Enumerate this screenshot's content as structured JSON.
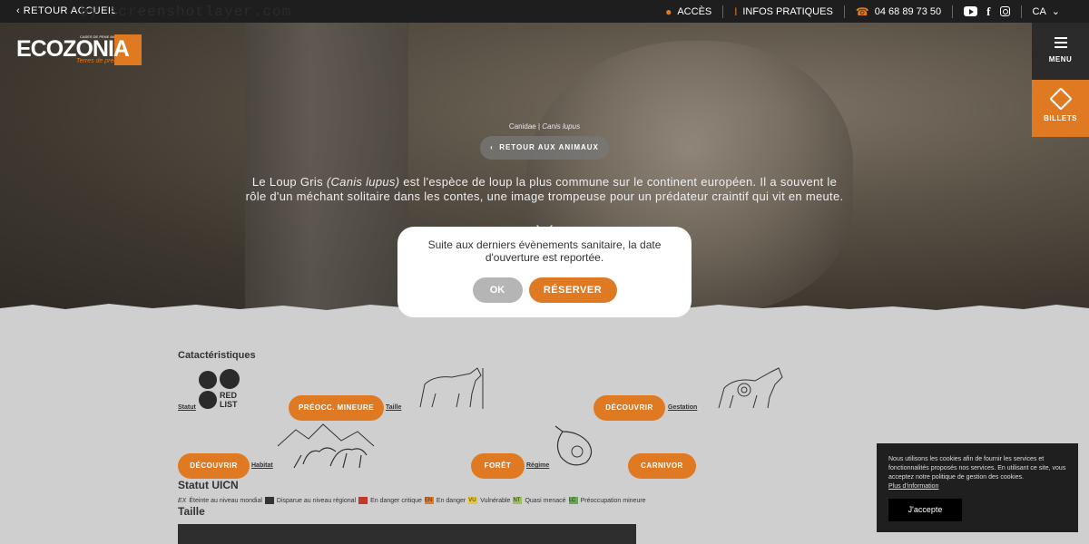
{
  "topbar": {
    "back_label": "RETOUR ACCUEIL",
    "watermark": "by screenshotlayer.com",
    "access_label": "ACCÈS",
    "info_label": "INFOS PRATIQUES",
    "phone": "04 68 89 73 50",
    "lang": "CA",
    "social_icons": [
      "youtube-icon",
      "facebook-icon",
      "instagram-icon"
    ]
  },
  "logo": {
    "word": "ECOZONIA",
    "tagline": "Terres de prédateurs",
    "tiny": "CASES DE PENE 66"
  },
  "side": {
    "menu_label": "MENU",
    "tickets_label": "BILLETS"
  },
  "hero": {
    "family": "Canidae |",
    "species": "Canis lupus",
    "back_button": "RETOUR AUX ANIMAUX",
    "intro_name": "Le Loup Gris",
    "intro_latin": "(Canis lupus)",
    "intro_text": "est l'espèce de loup la plus commune sur le continent européen. Il a souvent le rôle d'un méchant solitaire dans les contes, une image trompeuse pour un prédateur craintif qui vit en meute."
  },
  "modal": {
    "message": "Suite aux derniers évènements sanitaire, la date d'ouverture est reportée.",
    "ok_label": "OK",
    "reserve_label": "RÉSERVER"
  },
  "content": {
    "heading": "Catactéristiques",
    "redlist_text": "RED LIST",
    "statut_label": "Statut",
    "statut_value": "PRÉOCC. MINEURE",
    "taille_label": "Taille",
    "taille_value": "DÉCOUVRIR",
    "gestation_label": "Gestation",
    "habitat_value": "DÉCOUVRIR",
    "habitat_label": "Habitat",
    "habitat_type": "FORÊT",
    "regime_label": "Régime",
    "regime_value": "CARNIVOR",
    "uicn_heading": "Statut UICN",
    "legend": [
      {
        "code": "EX",
        "label": "Éteinte au niveau mondial",
        "color": ""
      },
      {
        "code": "",
        "label": "Disparue au niveau régional",
        "color": "#333333"
      },
      {
        "code": "",
        "label": "En danger critique",
        "color": "#c0392b"
      },
      {
        "code": "EN",
        "label": "En danger",
        "color": "#e07a22"
      },
      {
        "code": "VU",
        "label": "Vulnérable",
        "color": "#e8c83a"
      },
      {
        "code": "NT",
        "label": "Quasi menacé",
        "color": "#9bbf5a"
      },
      {
        "code": "LC",
        "label": "Préoccupation mineure",
        "color": "#6aa84f"
      }
    ],
    "taille_heading": "Taille"
  },
  "cookie": {
    "text": "Nous utilisons les cookies afin de fournir les services et fonctionnalités proposés nos services. En utilisant ce site, vous acceptez notre politique de gestion des cookies.",
    "more_link": "Plus d'information",
    "accept_label": "J'accepte"
  }
}
